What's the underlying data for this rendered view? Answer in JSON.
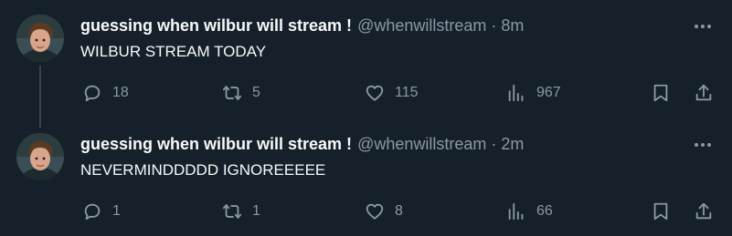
{
  "tweets": [
    {
      "name": "guessing when wilbur will stream !",
      "handle": "@whenwillstream",
      "separator": "·",
      "time": "8m",
      "text": "WILBUR STREAM TODAY",
      "replies": "18",
      "retweets": "5",
      "likes": "115",
      "views": "967"
    },
    {
      "name": "guessing when wilbur will stream !",
      "handle": "@whenwillstream",
      "separator": "·",
      "time": "2m",
      "text": "NEVERMINDDDDD IGNOREEEEE",
      "replies": "1",
      "retweets": "1",
      "likes": "8",
      "views": "66"
    }
  ],
  "icons": {
    "more": "more-horizontal-icon",
    "reply": "speech-bubble-icon",
    "retweet": "retweet-arrows-icon",
    "like": "heart-icon",
    "views": "bar-chart-icon",
    "bookmark": "bookmark-icon",
    "share": "share-upload-icon"
  },
  "colors": {
    "background": "#15202b",
    "text": "#f7f9f9",
    "muted": "#8b98a5",
    "thread_line": "#38444d"
  }
}
